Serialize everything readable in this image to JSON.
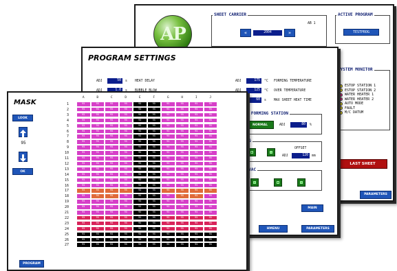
{
  "carrier_window": {
    "sheet_carrier_title": "SHEET CARRIER",
    "carrier_value": "2004",
    "carrier_side_text": "AB 1",
    "active_program_title": "ACTIVE PROGRAM",
    "active_program_value": "TESTPROG",
    "system_monitor_title": "SYSTEM MONITOR",
    "monitor_items": [
      {
        "label": "ESTOP STATION 1",
        "color": "#e8d81a"
      },
      {
        "label": "ESTOP STATION 2",
        "color": "#e8d81a"
      },
      {
        "label": "WATER HEATER 1",
        "color": "#e0308a"
      },
      {
        "label": "WATER HEATER 2",
        "color": "#e0308a"
      },
      {
        "label": "AUTO MODE",
        "color": "#e8d81a"
      },
      {
        "label": "FAULT",
        "color": "#e8d81a"
      },
      {
        "label": "M/C DATUM",
        "color": "#e8d81a"
      }
    ],
    "last_sheet_label": "LAST SHEET",
    "parameters_label": "PARAMETERS"
  },
  "program_window": {
    "title": "PROGRAM SETTINGS",
    "left_fields": [
      {
        "prefix": "ADJ",
        "value": "50",
        "unit": "s",
        "label": "HEAT DELAY"
      },
      {
        "prefix": "ADJ",
        "value": "1.0",
        "unit": "s",
        "label": "BUBBLE BLOW"
      }
    ],
    "right_fields": [
      {
        "prefix": "ADJ",
        "value": "175",
        "unit": "°C",
        "label": "FORMING TEMPERATURE"
      },
      {
        "prefix": "ADJ",
        "value": "125",
        "unit": "°C",
        "label": "OVER TEMPERATURE"
      },
      {
        "prefix": "ADJ",
        "value": "60",
        "unit": "s",
        "label": "MAX SHEET HEAT TIME"
      }
    ],
    "forming_station_title": "TO FORMING STATION",
    "normal_label": "NORMAL",
    "forming_adj": "ADJ",
    "forming_value": "80",
    "forming_unit": "%",
    "group2_title": "ING",
    "offset_label": "OFFSET",
    "offset_adj": "ADJ",
    "offset_value": "120",
    "offset_unit": "mm",
    "vac_title": "T VAC",
    "main_label": "MAIN",
    "hmenu_label": "HMENU",
    "parameters_label": "PARAMETERS"
  },
  "mask_window": {
    "title": "MASK",
    "look_label": "LOOK",
    "counter_value": "95",
    "ok_label": "OK",
    "program_label": "PROGRAM",
    "column_headers": [
      "A",
      "B",
      "C",
      "D",
      "E",
      "F",
      "G",
      "H",
      "I",
      "J"
    ],
    "row_labels": [
      "1",
      "2",
      "3",
      "4",
      "5",
      "6",
      "7",
      "8",
      "9",
      "10",
      "11",
      "12",
      "13",
      "14",
      "15",
      "16",
      "17",
      "18",
      "19",
      "20",
      "21",
      "22",
      "23",
      "24",
      "25",
      "26",
      "27"
    ],
    "cell_text": "95",
    "row_colors": [
      [
        "#d63fc8",
        "#d63fc8",
        "#d63fc8",
        "#d63fc8",
        "#000000",
        "#000000",
        "#d63fc8",
        "#d63fc8",
        "#d63fc8",
        "#d63fc8"
      ],
      [
        "#d63fc8",
        "#d63fc8",
        "#d63fc8",
        "#d63fc8",
        "#000000",
        "#000000",
        "#d63fc8",
        "#d63fc8",
        "#d63fc8",
        "#d63fc8"
      ],
      [
        "#d63fc8",
        "#d63fc8",
        "#d63fc8",
        "#d63fc8",
        "#000000",
        "#000000",
        "#d63fc8",
        "#d63fc8",
        "#d63fc8",
        "#d63fc8"
      ],
      [
        "#d63fc8",
        "#d63fc8",
        "#d63fc8",
        "#d63fc8",
        "#000000",
        "#000000",
        "#d63fc8",
        "#d63fc8",
        "#d63fc8",
        "#d63fc8"
      ],
      [
        "#d63fc8",
        "#d63fc8",
        "#d63fc8",
        "#d63fc8",
        "#000000",
        "#000000",
        "#d63fc8",
        "#d63fc8",
        "#d63fc8",
        "#d63fc8"
      ],
      [
        "#d63fc8",
        "#d63fc8",
        "#d63fc8",
        "#d63fc8",
        "#000000",
        "#000000",
        "#d63fc8",
        "#d63fc8",
        "#d63fc8",
        "#d63fc8"
      ],
      [
        "#d63fc8",
        "#d63fc8",
        "#d63fc8",
        "#d63fc8",
        "#000000",
        "#000000",
        "#d63fc8",
        "#d63fc8",
        "#d63fc8",
        "#d63fc8"
      ],
      [
        "#d63fc8",
        "#d63fc8",
        "#d63fc8",
        "#d63fc8",
        "#000000",
        "#000000",
        "#d63fc8",
        "#d63fc8",
        "#d63fc8",
        "#d63fc8"
      ],
      [
        "#d63fc8",
        "#d63fc8",
        "#d63fc8",
        "#d63fc8",
        "#000000",
        "#000000",
        "#d63fc8",
        "#d63fc8",
        "#d63fc8",
        "#d63fc8"
      ],
      [
        "#d63fc8",
        "#d63fc8",
        "#d63fc8",
        "#d63fc8",
        "#000000",
        "#000000",
        "#d63fc8",
        "#d63fc8",
        "#d63fc8",
        "#d63fc8"
      ],
      [
        "#d63fc8",
        "#d63fc8",
        "#d63fc8",
        "#d63fc8",
        "#000000",
        "#000000",
        "#d63fc8",
        "#d63fc8",
        "#d63fc8",
        "#d63fc8"
      ],
      [
        "#d63fc8",
        "#d63fc8",
        "#d63fc8",
        "#d63fc8",
        "#000000",
        "#000000",
        "#d63fc8",
        "#d63fc8",
        "#d63fc8",
        "#d63fc8"
      ],
      [
        "#d63fc8",
        "#d63fc8",
        "#d63fc8",
        "#d63fc8",
        "#000000",
        "#000000",
        "#d63fc8",
        "#d63fc8",
        "#d63fc8",
        "#d63fc8"
      ],
      [
        "#d63fc8",
        "#d63fc8",
        "#d63fc8",
        "#d63fc8",
        "#000000",
        "#000000",
        "#d63fc8",
        "#d63fc8",
        "#d63fc8",
        "#d63fc8"
      ],
      [
        "#d63fc8",
        "#d63fc8",
        "#d63fc8",
        "#d63fc8",
        "#000000",
        "#000000",
        "#d63fc8",
        "#d63fc8",
        "#d63fc8",
        "#d63fc8"
      ],
      [
        "#d63fc8",
        "#d63fc8",
        "#d63fc8",
        "#d63fc8",
        "#000000",
        "#000000",
        "#d63fc8",
        "#d63fc8",
        "#d63fc8",
        "#d63fc8"
      ],
      [
        "#e06a3a",
        "#e06a3a",
        "#e06a3a",
        "#e06a3a",
        "#000000",
        "#000000",
        "#e06a3a",
        "#e06a3a",
        "#e06a3a",
        "#e06a3a"
      ],
      [
        "#d63fc8",
        "#e06a3a",
        "#e06a3a",
        "#d63fc8",
        "#000000",
        "#000000",
        "#d63fc8",
        "#e06a3a",
        "#e06a3a",
        "#d63fc8"
      ],
      [
        "#d63fc8",
        "#d63fc8",
        "#d63fc8",
        "#d63fc8",
        "#000000",
        "#000000",
        "#d63fc8",
        "#d63fc8",
        "#d63fc8",
        "#d63fc8"
      ],
      [
        "#d63fc8",
        "#d63fc8",
        "#d63fc8",
        "#d63fc8",
        "#000000",
        "#000000",
        "#d63fc8",
        "#d63fc8",
        "#d63fc8",
        "#d63fc8"
      ],
      [
        "#d63fc8",
        "#d63fc8",
        "#d63fc8",
        "#d63fc8",
        "#000000",
        "#000000",
        "#d63fc8",
        "#d63fc8",
        "#d63fc8",
        "#d63fc8"
      ],
      [
        "#d8245a",
        "#d8245a",
        "#d8245a",
        "#d8245a",
        "#000000",
        "#000000",
        "#d8245a",
        "#d8245a",
        "#d8245a",
        "#d8245a"
      ],
      [
        "#d8245a",
        "#d8245a",
        "#d8245a",
        "#d8245a",
        "#000000",
        "#000000",
        "#d8245a",
        "#d8245a",
        "#d8245a",
        "#d8245a"
      ],
      [
        "#d8245a",
        "#d8245a",
        "#d8245a",
        "#d8245a",
        "#000000",
        "#000000",
        "#d8245a",
        "#d8245a",
        "#d8245a",
        "#d8245a"
      ],
      [
        "#000000",
        "#000000",
        "#000000",
        "#000000",
        "#000000",
        "#000000",
        "#000000",
        "#000000",
        "#000000",
        "#000000"
      ],
      [
        "#000000",
        "#000000",
        "#000000",
        "#000000",
        "#000000",
        "#000000",
        "#000000",
        "#000000",
        "#000000",
        "#000000"
      ],
      [
        "#000000",
        "#000000",
        "#000000",
        "#000000",
        "#000000",
        "#000000",
        "#000000",
        "#000000",
        "#000000",
        "#000000"
      ]
    ]
  },
  "logo_text": "AP"
}
